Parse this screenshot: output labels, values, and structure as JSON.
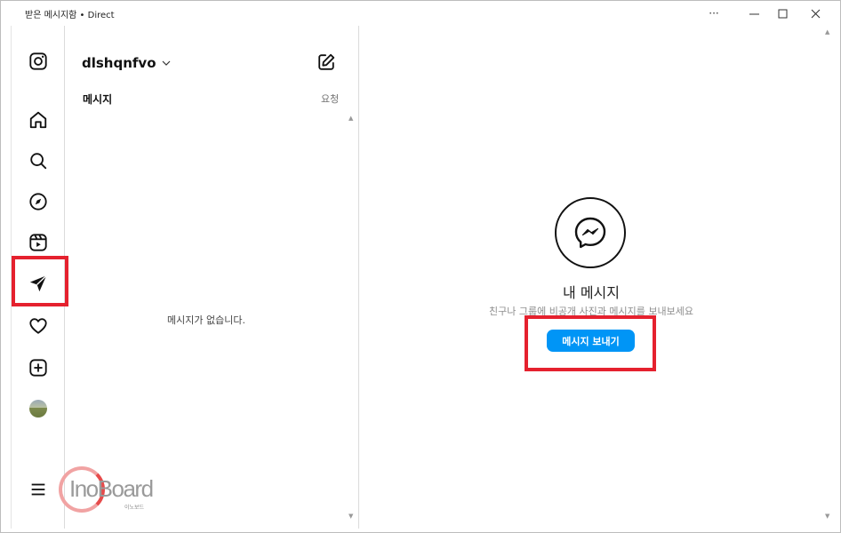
{
  "window": {
    "title": "받은 메시지함 • Direct",
    "controls": {
      "more": "···",
      "minimize": "—",
      "maximize": "☐",
      "close": "✕"
    }
  },
  "nav": {
    "items": [
      "instagram-logo",
      "home",
      "search",
      "explore",
      "reels",
      "direct-messages",
      "notifications",
      "create",
      "profile",
      "more-menu"
    ],
    "active": "direct-messages"
  },
  "conversations": {
    "username": "dlshqnfvo",
    "tab_messages": "메시지",
    "tab_requests": "요청",
    "empty_text": "메시지가 없습니다."
  },
  "main": {
    "title": "내 메시지",
    "subtitle": "친구나 그룹에 비공개 사진과 메시지를 보내보세요",
    "send_button": "메시지 보내기"
  },
  "watermark": {
    "text": "InoBoard",
    "sub": "이노보드"
  },
  "colors": {
    "accent": "#0095f6",
    "highlight": "#e5212e"
  }
}
